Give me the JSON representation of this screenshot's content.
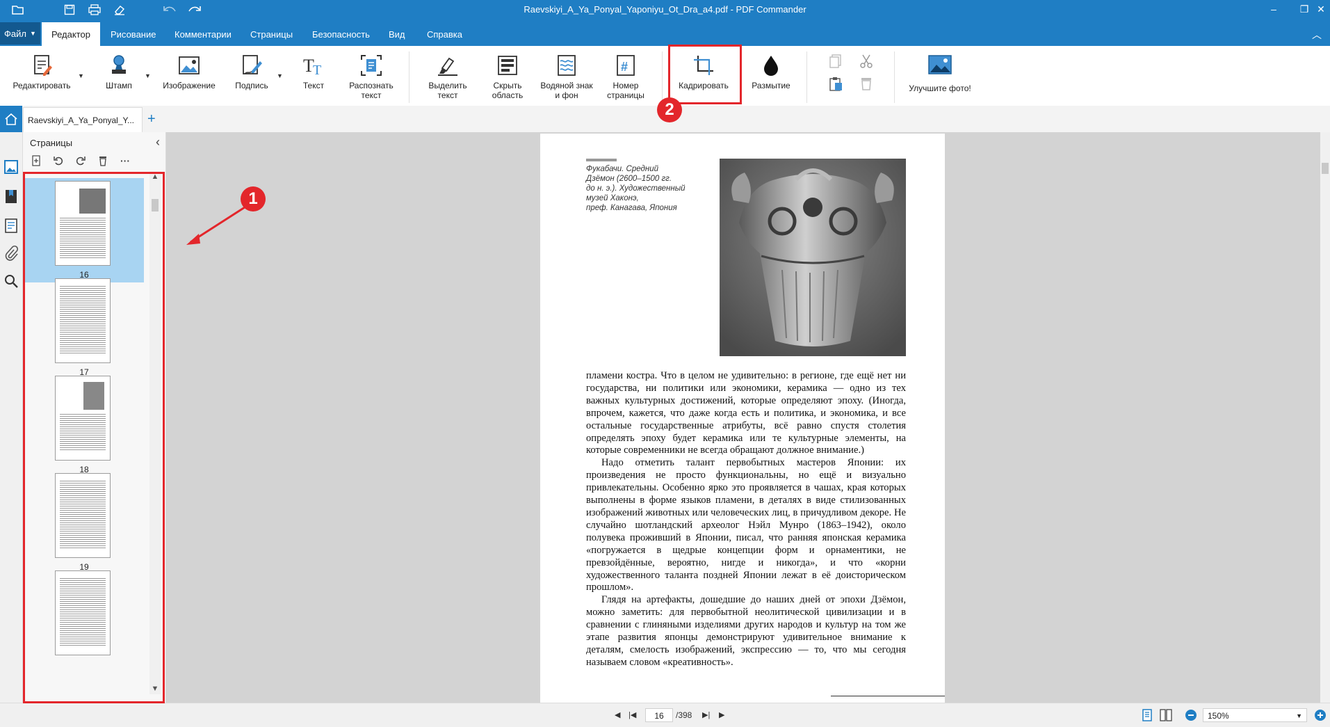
{
  "window": {
    "title": "Raevskiyi_A_Ya_Ponyal_Yaponiyu_Ot_Dra_a4.pdf - PDF Commander"
  },
  "menu": {
    "file_label": "Файл",
    "tabs": [
      {
        "label": "Редактор"
      },
      {
        "label": "Рисование"
      },
      {
        "label": "Комментарии"
      },
      {
        "label": "Страницы"
      },
      {
        "label": "Безопасность"
      },
      {
        "label": "Вид"
      },
      {
        "label": "Справка"
      }
    ]
  },
  "ribbon": {
    "edit": "Редактировать",
    "stamp": "Штамп",
    "image": "Изображение",
    "signature": "Подпись",
    "text": "Текст",
    "ocr_line1": "Распознать",
    "ocr_line2": "текст",
    "highlight_line1": "Выделить",
    "highlight_line2": "текст",
    "hide_line1": "Скрыть",
    "hide_line2": "область",
    "watermark_line1": "Водяной знак",
    "watermark_line2": "и фон",
    "pagenum_line1": "Номер",
    "pagenum_line2": "страницы",
    "crop": "Кадрировать",
    "blur": "Размытие",
    "enhance": "Улучшите фото!"
  },
  "tabs": {
    "document_tab": "Raevskiyi_A_Ya_Ponyal_Y..."
  },
  "pages_panel": {
    "title": "Страницы",
    "thumbnails": [
      {
        "number": "16",
        "selected": true
      },
      {
        "number": "17",
        "selected": false
      },
      {
        "number": "18",
        "selected": false
      },
      {
        "number": "19",
        "selected": false
      },
      {
        "number": "",
        "selected": false
      }
    ]
  },
  "document": {
    "caption_lines": [
      "Фукабачи. Средний",
      "Дзёмон (2600–1500 гг.",
      "до н. э.). Художественный",
      "музей Хаконэ,",
      "преф. Канагава, Япония"
    ],
    "paragraphs": [
      "пламени костра. Что в целом не удивительно: в регионе, где ещё нет ни государства, ни политики или экономики, керамика — одно из тех важных культурных достижений, которые определяют эпоху. (Иногда, впрочем, кажется, что даже когда есть и политика, и экономика, и все остальные государственные атрибуты, всё равно спустя столетия определять эпоху будет керамика или те культурные элементы, на которые современники не всегда обращают должное внимание.)",
      "Надо отметить талант первобытных мастеров Японии: их произведения не просто функциональны, но ещё и визуально привлекательны. Особенно ярко это проявляется в чашах, края которых выполнены в форме языков пламени, в деталях в виде стилизованных изображений животных или человеческих лиц, в причудливом декоре. Не случайно шотландский археолог Нэйл Мунро (1863–1942), около полувека проживший в Японии, писал, что ранняя японская керамика «погружается в щедрые концепции форм и орнаментики, не превзойдённые, вероятно, нигде и никогда», и что «корни художественного таланта поздней Японии лежат в её доисторическом прошлом».",
      "Глядя на артефакты, дошедшие до наших дней от эпохи Дзёмон, можно заметить: для первобытной неолитической цивилизации и в сравнении с глиняными изделиями других народов и культур на том же этапе развития японцы демонстрируют удивительное внимание к деталям, смелость изображений, экспрессию — то, что мы сегодня называем словом «креативность»."
    ]
  },
  "status": {
    "current_page": "16",
    "total_pages": "/398",
    "zoom": "150%"
  },
  "annotations": {
    "badge1": "1",
    "badge2": "2",
    "color": "#e3262b"
  },
  "colors": {
    "accent": "#1f7ec4",
    "selected_thumb": "#a8d4f2"
  }
}
